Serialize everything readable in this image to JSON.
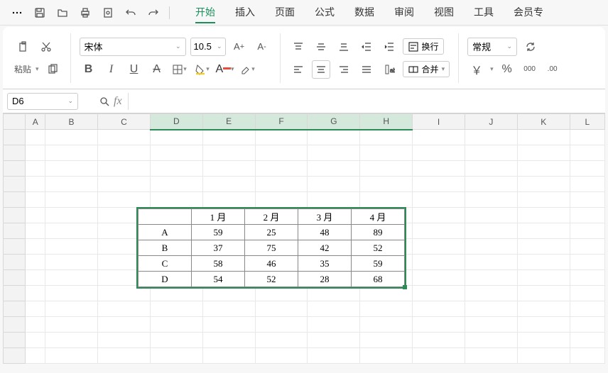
{
  "quick": {
    "save": "保存",
    "open": "打开",
    "print": "打印",
    "preview": "预览",
    "undo": "撤销",
    "redo": "重做"
  },
  "menus": {
    "start": "开始",
    "insert": "插入",
    "page": "页面",
    "formula": "公式",
    "data": "数据",
    "review": "审阅",
    "view": "视图",
    "tools": "工具",
    "member": "会员专"
  },
  "ribbon": {
    "paste": "粘贴",
    "font_name": "宋体",
    "font_size": "10.5",
    "wrap": "换行",
    "merge": "合并",
    "format": "常规",
    "currency": "￥",
    "percent": "%",
    "thousand": "000",
    "decimals": ".00"
  },
  "namebox": "D6",
  "fx": "fx",
  "columns": [
    "A",
    "B",
    "C",
    "D",
    "E",
    "F",
    "G",
    "H",
    "I",
    "J",
    "K",
    "L"
  ],
  "selected_cols": [
    "D",
    "E",
    "F",
    "G",
    "H"
  ],
  "chart_data": {
    "type": "table",
    "title": "",
    "headers": [
      "",
      "1 月",
      "2 月",
      "3 月",
      "4 月"
    ],
    "rows": [
      [
        "A",
        59,
        25,
        48,
        89
      ],
      [
        "B",
        37,
        75,
        42,
        52
      ],
      [
        "C",
        58,
        46,
        35,
        59
      ],
      [
        "D",
        54,
        52,
        28,
        68
      ]
    ]
  }
}
